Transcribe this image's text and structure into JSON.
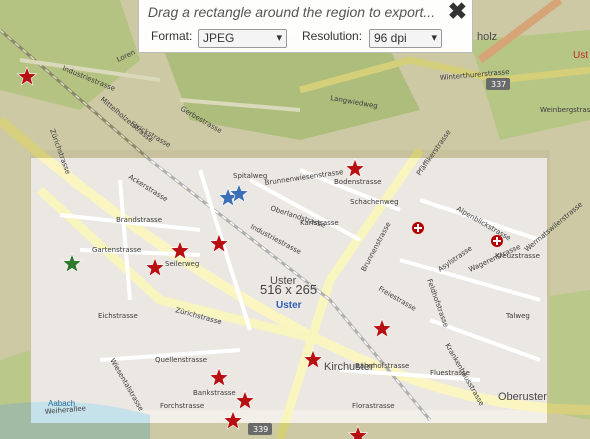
{
  "export_panel": {
    "hint": "Drag a rectangle around the region to export...",
    "format_label": "Format:",
    "format_value": "JPEG",
    "resolution_label": "Resolution:",
    "resolution_value": "96 dpi",
    "close_glyph": "✖"
  },
  "selection": {
    "dimensions": "516 x 265"
  },
  "map": {
    "place_labels": {
      "uster": "Uster",
      "oberuster": "Oberuster",
      "kirchuster": "Kirchuster",
      "aabach": "Aabach",
      "holz": "holz",
      "ust": "Ust"
    },
    "road_shields": {
      "route_337": "337",
      "route_339": "339"
    },
    "street_labels": {
      "industriestrasse_nw": "Industriestrasse",
      "loren": "Loren",
      "pfaeffikerstrasse": "Pfäffikerstrasse",
      "zurichstrasse_w": "Zürichstrasse",
      "zurichstrasse_c": "Zürichstrasse",
      "brandstrasse": "Brandstrasse",
      "gartenstrasse": "Gartenstrasse",
      "seilerweg": "Seilerweg",
      "ackerstrasse": "Ackerstrasse",
      "brunnenwiesen": "Brunnenwiesenstrasse",
      "bodenstrasse": "Bodenstrasse",
      "karlstrasse": "Karlstrasse",
      "industriestrasse_c": "Industriestrasse",
      "oberlandstrasse": "Oberlandstrasse",
      "brunnenstrasse": "Brunnenstrasse",
      "schachenweg": "Schachenweg",
      "freiestrasse": "Freiestrasse",
      "bahnhofstrasse": "Bahnhofstrasse",
      "fluestrasse": "Fluestrasse",
      "florastrasse": "Florastrasse",
      "quellenstrasse": "Quellenstrasse",
      "eichstrasse": "Eichstrasse",
      "weiherallee": "Weiherallee",
      "wagerenstrasse": "Wagerenstrasse",
      "asylstrasse": "Asylstrasse",
      "krankenhausstrasse": "Krankenhausstrasse",
      "feldhofstrasse": "Feldhofstrasse",
      "weinbergstrasse": "Weinbergstrasse",
      "talweg": "Talweg",
      "langwiedweg": "Langwiedweg",
      "gerbestrasse": "Gerbestrasse",
      "wermatswilerstrasse": "Wermatswilerstrasse",
      "winterthurerstrasse": "Winterthurerstrasse",
      "mittelholzerstrasse": "Mittelholzerstrasse",
      "strickstrasse": "Strickstrasse",
      "kreuzstrasse": "Kreuzstrasse",
      "alpenblickstrasse": "Alpenblickstrasse",
      "bankstrasse": "Bankstrasse",
      "forchstrasse": "Forchstrasse",
      "wiesentalstrasse": "Wiesentalstrasse",
      "spitalweg": "Spitalweg"
    },
    "colors": {
      "red_marker": "#b80f12",
      "blue_marker": "#3a6fb8",
      "green_marker": "#2f7a2f",
      "selection_overlay": "#ffffff",
      "outer_shade": "#8f8a2a"
    }
  }
}
